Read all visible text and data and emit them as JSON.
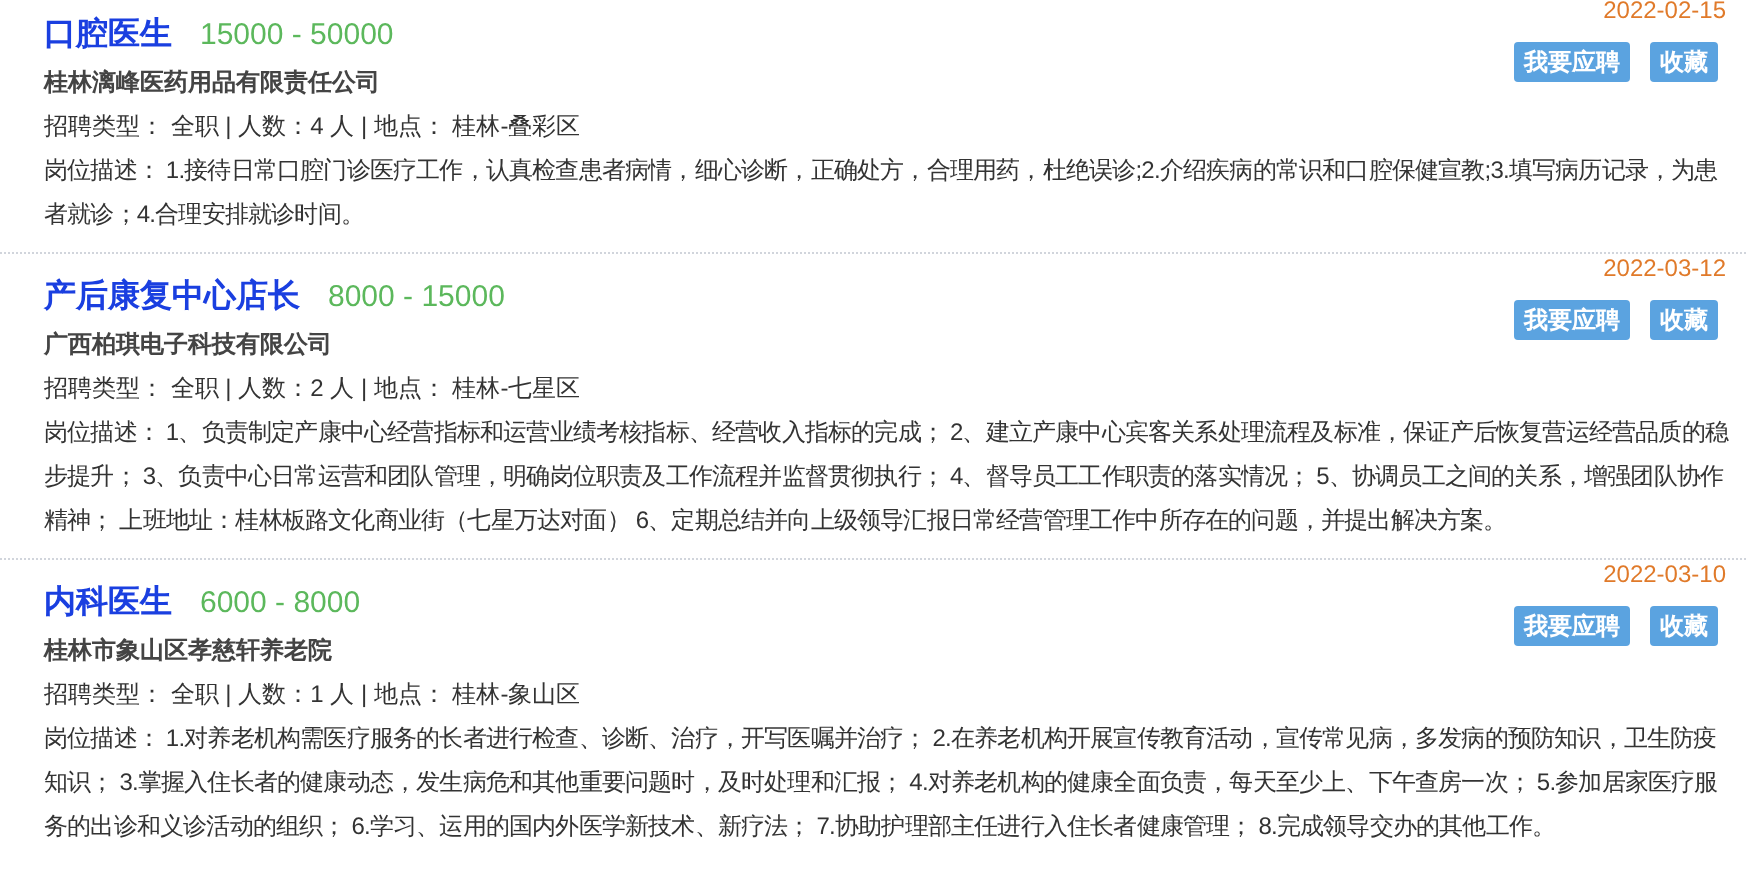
{
  "jobs": [
    {
      "title": "口腔医生",
      "salary": "15000 - 50000",
      "date": "2022-02-15",
      "company": "桂林漓峰医药用品有限责任公司",
      "meta": "招聘类型： 全职 | 人数：4 人 | 地点： 桂林-叠彩区",
      "description": "岗位描述： 1.接待日常口腔门诊医疗工作，认真检查患者病情，细心诊断，正确处方，合理用药，杜绝误诊;2.介绍疾病的常识和口腔保健宣教;3.填写病历记录，为患者就诊；4.合理安排就诊时间。",
      "buttons": [
        "我要应聘",
        "收藏"
      ]
    },
    {
      "title": "产后康复中心店长",
      "salary": "8000 - 15000",
      "date": "2022-03-12",
      "company": "广西柏琪电子科技有限公司",
      "meta": "招聘类型： 全职 | 人数：2 人 | 地点： 桂林-七星区",
      "description": "岗位描述： 1、负责制定产康中心经营指标和运营业绩考核指标、经营收入指标的完成； 2、建立产康中心宾客关系处理流程及标准，保证产后恢复营运经营品质的稳步提升； 3、负责中心日常运营和团队管理，明确岗位职责及工作流程并监督贯彻执行； 4、督导员工工作职责的落实情况； 5、协调员工之间的关系，增强团队协作精神； 上班地址：桂林板路文化商业街（七星万达对面） 6、定期总结并向上级领导汇报日常经营管理工作中所存在的问题，并提出解决方案。",
      "buttons": [
        "我要应聘",
        "收藏"
      ]
    },
    {
      "title": "内科医生",
      "salary": "6000 - 8000",
      "date": "2022-03-10",
      "company": "桂林市象山区孝慈轩养老院",
      "meta": "招聘类型： 全职 | 人数：1 人 | 地点： 桂林-象山区",
      "description": "岗位描述： 1.对养老机构需医疗服务的长者进行检查、诊断、治疗，开写医嘱并治疗； 2.在养老机构开展宣传教育活动，宣传常见病，多发病的预防知识，卫生防疫知识； 3.掌握入住长者的健康动态，发生病危和其他重要问题时，及时处理和汇报； 4.对养老机构的健康全面负责，每天至少上、下午查房一次； 5.参加居家医疗服务的出诊和义诊活动的组织； 6.学习、运用的国内外医学新技术、新疗法； 7.协助护理部主任进行入住长者健康管理； 8.完成领导交办的其他工作。",
      "buttons": [
        "我要应聘",
        "收藏"
      ]
    }
  ]
}
